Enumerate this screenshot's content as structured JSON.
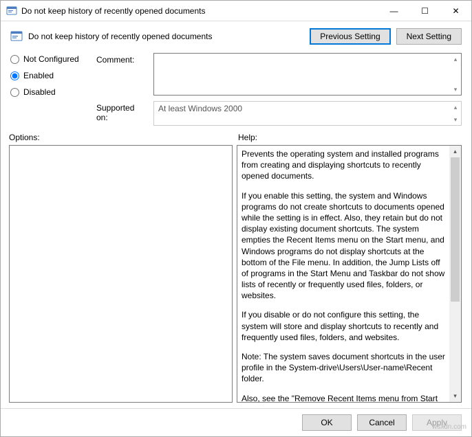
{
  "window": {
    "title": "Do not keep history of recently opened documents",
    "controls": {
      "minimize": "—",
      "maximize": "☐",
      "close": "✕"
    }
  },
  "header": {
    "policy_title": "Do not keep history of recently opened documents",
    "prev_button": "Previous Setting",
    "next_button": "Next Setting"
  },
  "radios": {
    "not_configured": "Not Configured",
    "enabled": "Enabled",
    "disabled": "Disabled",
    "selected": "enabled"
  },
  "fields": {
    "comment_label": "Comment:",
    "comment_value": "",
    "supported_label": "Supported on:",
    "supported_value": "At least Windows 2000"
  },
  "labels": {
    "options": "Options:",
    "help": "Help:"
  },
  "options_content": "",
  "help_paragraphs": [
    "Prevents the operating system and installed programs from creating and displaying shortcuts to recently opened documents.",
    "If you enable this setting, the system and Windows programs do not create shortcuts to documents opened while the setting is in effect. Also, they retain but do not display existing document shortcuts. The system empties the Recent Items menu on the Start menu, and Windows programs do not display shortcuts at the bottom of the File menu. In addition, the Jump Lists off of programs in the Start Menu and Taskbar do not show lists of recently or frequently used files, folders, or websites.",
    "If you disable or do not configure this setting, the system will store and display shortcuts to recently and frequently used files, folders, and websites.",
    "Note: The system saves document shortcuts in the user profile in the System-drive\\Users\\User-name\\Recent folder.",
    "Also, see the \"Remove Recent Items menu from Start Menu\" and \"Clear history of recently opened documents on exit\" policies in"
  ],
  "footer": {
    "ok": "OK",
    "cancel": "Cancel",
    "apply": "Apply"
  },
  "watermark": "wsxdn.com"
}
